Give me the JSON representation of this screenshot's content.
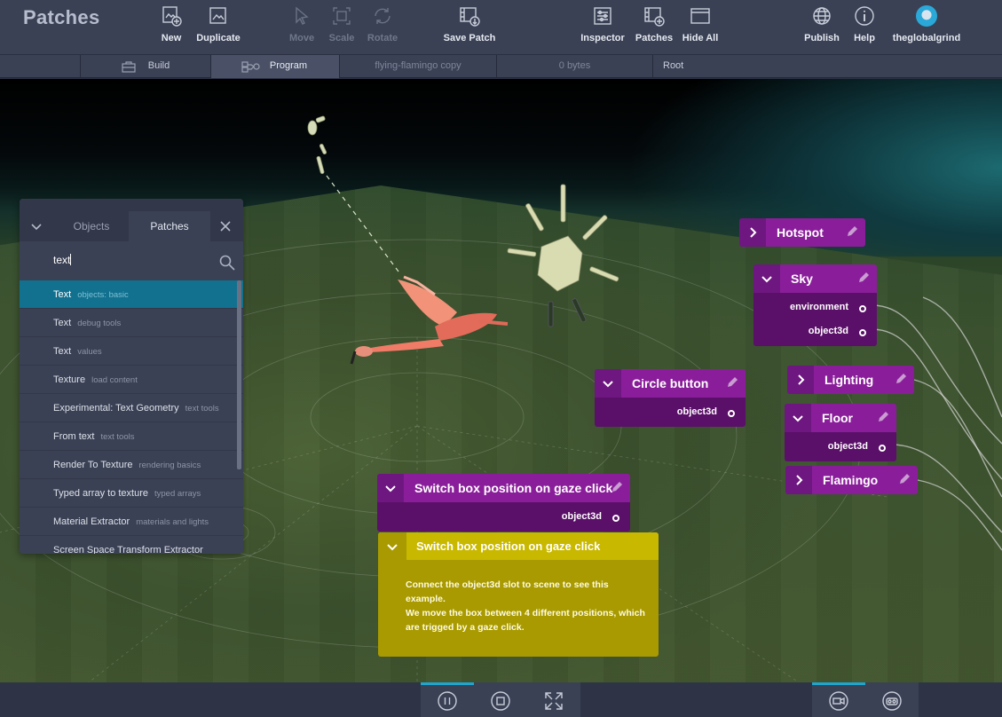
{
  "app": {
    "title": "Patches"
  },
  "toolbar": {
    "new": "New",
    "duplicate": "Duplicate",
    "move": "Move",
    "scale": "Scale",
    "rotate": "Rotate",
    "save_patch": "Save Patch",
    "inspector": "Inspector",
    "patches": "Patches",
    "hide_all": "Hide All",
    "publish": "Publish",
    "help": "Help",
    "user": "theglobalgrind"
  },
  "tabs": {
    "build": "Build",
    "program": "Program",
    "project_name": "flying-flamingo copy",
    "size": "0 bytes",
    "root": "Root"
  },
  "panel": {
    "tab_objects": "Objects",
    "tab_patches": "Patches",
    "search_value": "text",
    "results": [
      {
        "name": "Text",
        "category": "objects: basic",
        "selected": true
      },
      {
        "name": "Text",
        "category": "debug tools"
      },
      {
        "name": "Text",
        "category": "values"
      },
      {
        "name": "Texture",
        "category": "load content"
      },
      {
        "name": "Experimental: Text Geometry",
        "category": "text tools"
      },
      {
        "name": "From text",
        "category": "text tools"
      },
      {
        "name": "Render To Texture",
        "category": "rendering basics"
      },
      {
        "name": "Typed array to texture",
        "category": "typed arrays"
      },
      {
        "name": "Material Extractor",
        "category": "materials and lights"
      },
      {
        "name": "Screen Space Transform Extractor",
        "category": ""
      }
    ]
  },
  "nodes": {
    "hotspot": {
      "title": "Hotspot"
    },
    "sky": {
      "title": "Sky",
      "port1": "environment",
      "port2": "object3d"
    },
    "circle_button": {
      "title": "Circle button",
      "port1": "object3d"
    },
    "lighting": {
      "title": "Lighting"
    },
    "floor": {
      "title": "Floor",
      "port1": "object3d"
    },
    "flamingo": {
      "title": "Flamingo"
    },
    "switch_box": {
      "title": "Switch box position on gaze click",
      "port1": "object3d"
    }
  },
  "comment": {
    "title": "Switch box position on gaze click",
    "line1": "Connect the object3d slot to scene to see this example.",
    "line2": "We move the box between 4 different positions,  which",
    "line3": "are trigged by a gaze click."
  },
  "colors": {
    "node_header": "#8a1e9a",
    "node_body": "#5a1068",
    "comment": "#c9b800",
    "selection": "#11718f",
    "accent": "#1fa5d0"
  }
}
